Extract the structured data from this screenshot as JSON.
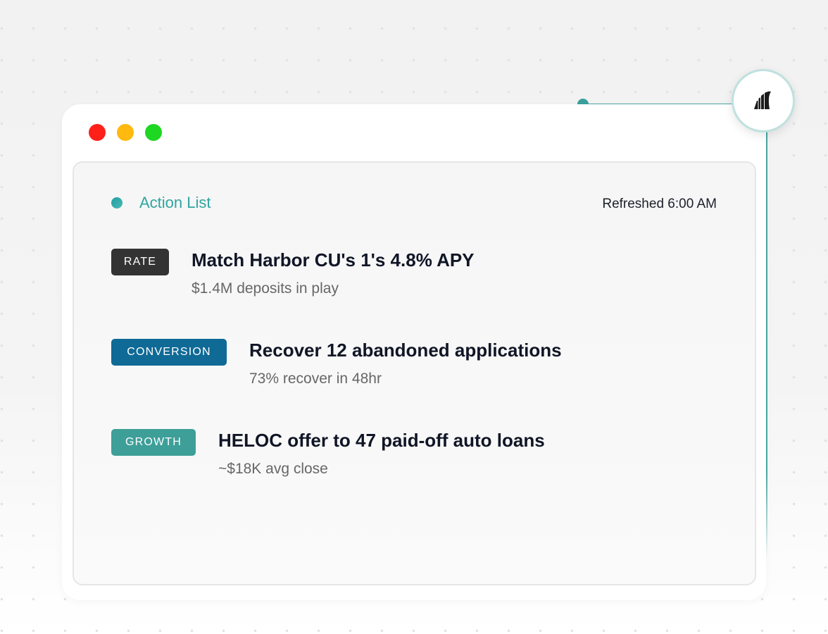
{
  "window": {
    "traffic_lights": [
      "close",
      "minimize",
      "maximize"
    ]
  },
  "panel": {
    "title": "Action List",
    "status": "Refreshed 6:00 AM"
  },
  "actions": [
    {
      "badge": "RATE",
      "badge_color": "#333333",
      "title": "Match Harbor CU's 1's 4.8% APY",
      "subtitle": "$1.4M deposits in play"
    },
    {
      "badge": "CONVERSION",
      "badge_color": "#0f6a96",
      "title": "Recover 12 abandoned applications",
      "subtitle": "73% recover in 48hr"
    },
    {
      "badge": "GROWTH",
      "badge_color": "#3d9f98",
      "title": "HELOC offer to 47 paid-off auto loans",
      "subtitle": "~$18K avg close"
    }
  ],
  "colors": {
    "accent": "#2fa59e",
    "connector": "#4aa8a4"
  },
  "icons": {
    "logo": "fin-logo-icon",
    "status": "status-dot-icon"
  }
}
